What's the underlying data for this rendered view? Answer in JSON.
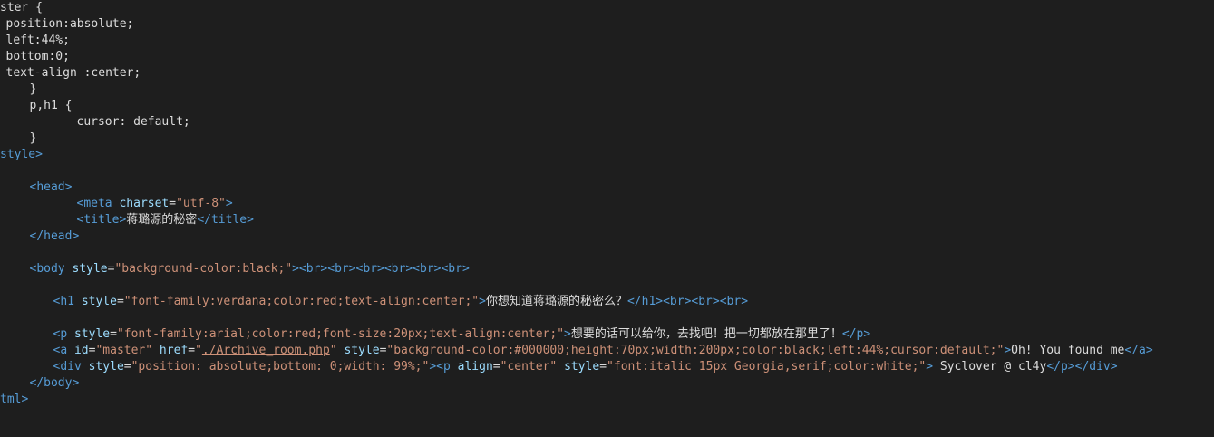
{
  "colors": {
    "background": "#1e1e1e",
    "text": "#dcdcdc",
    "tag": "#569cd6",
    "attribute": "#9cdcfe",
    "string": "#ce9178"
  },
  "lines": [
    {
      "indent": 0,
      "offset": -6,
      "tokens": [
        {
          "t": "ster {",
          "c": "css"
        }
      ]
    },
    {
      "indent": 1,
      "offset": 0,
      "tokens": [
        {
          "t": "position:absolute;",
          "c": "css"
        }
      ]
    },
    {
      "indent": 1,
      "offset": 0,
      "tokens": [
        {
          "t": "left:44%;",
          "c": "css"
        }
      ]
    },
    {
      "indent": 1,
      "offset": 0,
      "tokens": [
        {
          "t": "bottom:0;",
          "c": "css"
        }
      ]
    },
    {
      "indent": 1,
      "offset": 0,
      "tokens": [
        {
          "t": "text-align :center;",
          "c": "css"
        }
      ]
    },
    {
      "indent": 5,
      "offset": 0,
      "tokens": [
        {
          "t": "}",
          "c": "css"
        }
      ]
    },
    {
      "indent": 5,
      "offset": 0,
      "tokens": [
        {
          "t": "p,h1 {",
          "c": "css"
        }
      ]
    },
    {
      "indent": 13,
      "offset": 0,
      "tokens": [
        {
          "t": "cursor: default;",
          "c": "css"
        }
      ]
    },
    {
      "indent": 5,
      "offset": 0,
      "tokens": [
        {
          "t": "}",
          "c": "css"
        }
      ]
    },
    {
      "indent": 0,
      "offset": -4,
      "tokens": [
        {
          "t": "style>",
          "c": "tag"
        }
      ]
    },
    {
      "indent": 0,
      "offset": 0,
      "tokens": []
    },
    {
      "indent": 5,
      "offset": 0,
      "tokens": [
        {
          "t": "<head>",
          "c": "tag"
        }
      ]
    },
    {
      "indent": 13,
      "offset": 0,
      "tokens": [
        {
          "t": "<meta ",
          "c": "tag"
        },
        {
          "t": "charset",
          "c": "attr"
        },
        {
          "t": "=",
          "c": "plain"
        },
        {
          "t": "\"utf-8\"",
          "c": "str"
        },
        {
          "t": ">",
          "c": "tag"
        }
      ]
    },
    {
      "indent": 13,
      "offset": 0,
      "tokens": [
        {
          "t": "<title>",
          "c": "tag"
        },
        {
          "t": "蒋璐源的秘密",
          "c": "plain"
        },
        {
          "t": "</title>",
          "c": "tag"
        }
      ]
    },
    {
      "indent": 5,
      "offset": 0,
      "tokens": [
        {
          "t": "</head>",
          "c": "tag"
        }
      ]
    },
    {
      "indent": 0,
      "offset": 0,
      "tokens": []
    },
    {
      "indent": 5,
      "offset": 0,
      "tokens": [
        {
          "t": "<body ",
          "c": "tag"
        },
        {
          "t": "style",
          "c": "attr"
        },
        {
          "t": "=",
          "c": "plain"
        },
        {
          "t": "\"background-color:black;\"",
          "c": "str"
        },
        {
          "t": "><br><br><br><br><br><br>",
          "c": "tag"
        }
      ]
    },
    {
      "indent": 0,
      "offset": 0,
      "tokens": []
    },
    {
      "indent": 9,
      "offset": 0,
      "tokens": [
        {
          "t": "<h1 ",
          "c": "tag"
        },
        {
          "t": "style",
          "c": "attr"
        },
        {
          "t": "=",
          "c": "plain"
        },
        {
          "t": "\"font-family:verdana;color:red;text-align:center;\"",
          "c": "str"
        },
        {
          "t": ">",
          "c": "tag"
        },
        {
          "t": "你想知道蒋璐源的秘密么？",
          "c": "plain"
        },
        {
          "t": "</h1><br><br><br>",
          "c": "tag"
        }
      ]
    },
    {
      "indent": 0,
      "offset": 0,
      "tokens": []
    },
    {
      "indent": 9,
      "offset": 0,
      "tokens": [
        {
          "t": "<p ",
          "c": "tag"
        },
        {
          "t": "style",
          "c": "attr"
        },
        {
          "t": "=",
          "c": "plain"
        },
        {
          "t": "\"font-family:arial;color:red;font-size:20px;text-align:center;\"",
          "c": "str"
        },
        {
          "t": ">",
          "c": "tag"
        },
        {
          "t": "想要的话可以给你，去找吧！把一切都放在那里了！",
          "c": "plain"
        },
        {
          "t": "</p>",
          "c": "tag"
        }
      ]
    },
    {
      "indent": 9,
      "offset": 0,
      "tokens": [
        {
          "t": "<a ",
          "c": "tag"
        },
        {
          "t": "id",
          "c": "attr"
        },
        {
          "t": "=",
          "c": "plain"
        },
        {
          "t": "\"master\"",
          "c": "str"
        },
        {
          "t": " ",
          "c": "plain"
        },
        {
          "t": "href",
          "c": "attr"
        },
        {
          "t": "=",
          "c": "plain"
        },
        {
          "t": "\"",
          "c": "str"
        },
        {
          "t": "./Archive_room.php",
          "c": "link"
        },
        {
          "t": "\"",
          "c": "str"
        },
        {
          "t": " ",
          "c": "plain"
        },
        {
          "t": "style",
          "c": "attr"
        },
        {
          "t": "=",
          "c": "plain"
        },
        {
          "t": "\"background-color:#000000;height:70px;width:200px;color:black;left:44%;cursor:default;\"",
          "c": "str"
        },
        {
          "t": ">",
          "c": "tag"
        },
        {
          "t": "Oh! You found me",
          "c": "plain"
        },
        {
          "t": "</a>",
          "c": "tag"
        }
      ]
    },
    {
      "indent": 9,
      "offset": 0,
      "tokens": [
        {
          "t": "<div ",
          "c": "tag"
        },
        {
          "t": "style",
          "c": "attr"
        },
        {
          "t": "=",
          "c": "plain"
        },
        {
          "t": "\"position: absolute;bottom: 0;width: 99%;\"",
          "c": "str"
        },
        {
          "t": "><p ",
          "c": "tag"
        },
        {
          "t": "align",
          "c": "attr"
        },
        {
          "t": "=",
          "c": "plain"
        },
        {
          "t": "\"center\"",
          "c": "str"
        },
        {
          "t": " ",
          "c": "plain"
        },
        {
          "t": "style",
          "c": "attr"
        },
        {
          "t": "=",
          "c": "plain"
        },
        {
          "t": "\"font:italic 15px Georgia,serif;color:white;\"",
          "c": "str"
        },
        {
          "t": ">",
          "c": "tag"
        },
        {
          "t": " Syclover @ cl4y",
          "c": "plain"
        },
        {
          "t": "</p></div>",
          "c": "tag"
        }
      ]
    },
    {
      "indent": 5,
      "offset": 0,
      "tokens": [
        {
          "t": "</body>",
          "c": "tag"
        }
      ]
    },
    {
      "indent": 0,
      "offset": -3,
      "tokens": [
        {
          "t": "tml>",
          "c": "tag"
        }
      ]
    }
  ]
}
